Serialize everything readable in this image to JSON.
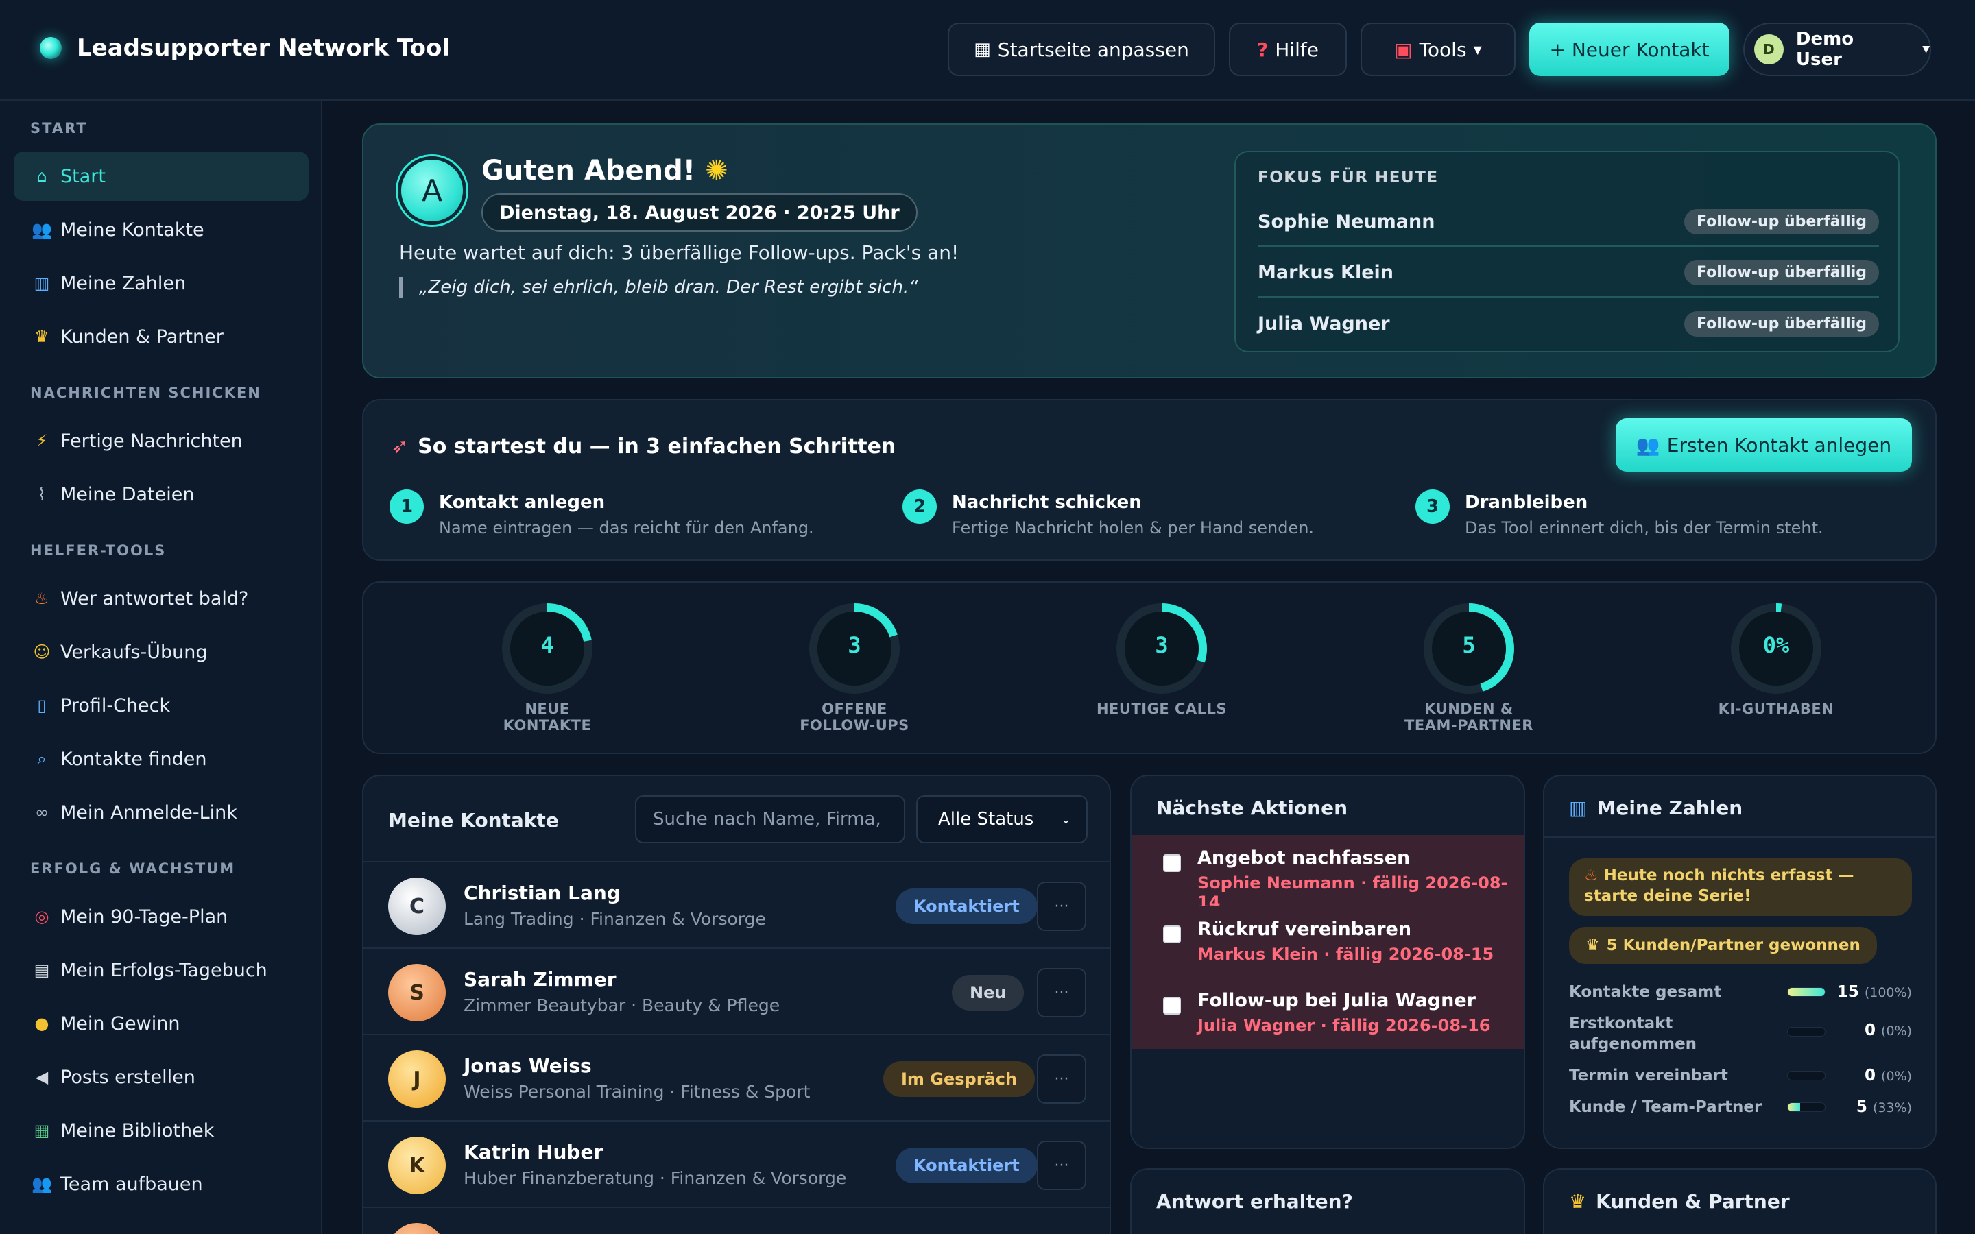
{
  "app": {
    "title": "Leadsupporter Network Tool"
  },
  "topbar": {
    "customize": "Startseite anpassen",
    "help": "Hilfe",
    "tools": "Tools",
    "new_contact": "+ Neuer Kontakt",
    "user_initial": "D",
    "user_name": "Demo User"
  },
  "sidebar": {
    "sections": [
      "START",
      "NACHRICHTEN SCHICKEN",
      "HELFER-TOOLS",
      "ERFOLG & WACHSTUM"
    ],
    "items": [
      {
        "label": "Start",
        "icon": "house-icon"
      },
      {
        "label": "Meine Kontakte",
        "icon": "people-icon"
      },
      {
        "label": "Meine Zahlen",
        "icon": "bar-chart-icon"
      },
      {
        "label": "Kunden & Partner",
        "icon": "trophy-icon"
      },
      {
        "label": "Fertige Nachrichten",
        "icon": "lightning-icon"
      },
      {
        "label": "Meine Dateien",
        "icon": "paperclip-icon"
      },
      {
        "label": "Wer antwortet bald?",
        "icon": "fire-icon"
      },
      {
        "label": "Verkaufs-Übung",
        "icon": "masks-icon"
      },
      {
        "label": "Profil-Check",
        "icon": "phone-icon"
      },
      {
        "label": "Kontakte finden",
        "icon": "magnifier-icon"
      },
      {
        "label": "Mein Anmelde-Link",
        "icon": "link-icon"
      },
      {
        "label": "Mein 90-Tage-Plan",
        "icon": "target-icon"
      },
      {
        "label": "Mein Erfolgs-Tagebuch",
        "icon": "notebook-icon"
      },
      {
        "label": "Mein Gewinn",
        "icon": "money-bag-icon"
      },
      {
        "label": "Posts erstellen",
        "icon": "megaphone-icon"
      },
      {
        "label": "Meine Bibliothek",
        "icon": "books-icon"
      },
      {
        "label": "Team aufbauen",
        "icon": "people-icon"
      }
    ]
  },
  "hero": {
    "initial": "A",
    "greeting": "Guten Abend!",
    "date": "Dienstag, 18. August 2026 · 20:25 Uhr",
    "message": "Heute wartet auf dich: 3 überfällige Follow-ups. Pack's an!",
    "quote": "„Zeig dich, sei ehrlich, bleib dran. Der Rest ergibt sich.“",
    "focus_title": "FOKUS FÜR HEUTE",
    "focus": [
      {
        "name": "Sophie Neumann",
        "badge": "Follow-up überfällig"
      },
      {
        "name": "Markus Klein",
        "badge": "Follow-up überfällig"
      },
      {
        "name": "Julia Wagner",
        "badge": "Follow-up überfällig"
      }
    ]
  },
  "onboarding": {
    "title": "So startest du — in 3 einfachen Schritten",
    "cta": "Ersten Kontakt anlegen",
    "steps": [
      {
        "num": "1",
        "title": "Kontakt anlegen",
        "sub": "Name eintragen — das reicht für den Anfang."
      },
      {
        "num": "2",
        "title": "Nachricht schicken",
        "sub": "Fertige Nachricht holen & per Hand senden."
      },
      {
        "num": "3",
        "title": "Dranbleiben",
        "sub": "Das Tool erinnert dich, bis der Termin steht."
      }
    ]
  },
  "kpis": [
    {
      "value": "4",
      "label1": "NEUE",
      "label2": "KONTAKTE",
      "fraction": 0.22
    },
    {
      "value": "3",
      "label1": "OFFENE",
      "label2": "FOLLOW-UPS",
      "fraction": 0.2
    },
    {
      "value": "3",
      "label1": "HEUTIGE CALLS",
      "label2": "",
      "fraction": 0.3
    },
    {
      "value": "5",
      "label1": "KUNDEN &",
      "label2": "TEAM-PARTNER",
      "fraction": 0.45
    },
    {
      "value": "0%",
      "label1": "KI-GUTHABEN",
      "label2": "",
      "fraction": 0.02
    }
  ],
  "contacts": {
    "title": "Meine Kontakte",
    "search_placeholder": "Suche nach Name, Firma,",
    "filter": "Alle Status",
    "rows": [
      {
        "initial": "C",
        "name": "Christian Lang",
        "sub": "Lang Trading · Finanzen & Vorsorge",
        "status": "Kontaktiert"
      },
      {
        "initial": "S",
        "name": "Sarah Zimmer",
        "sub": "Zimmer Beautybar · Beauty & Pflege",
        "status": "Neu"
      },
      {
        "initial": "J",
        "name": "Jonas Weiss",
        "sub": "Weiss Personal Training · Fitness & Sport",
        "status": "Im Gespräch"
      },
      {
        "initial": "K",
        "name": "Katrin Huber",
        "sub": "Huber Finanzberatung · Finanzen & Vorsorge",
        "status": "Kontaktiert"
      }
    ]
  },
  "actions": {
    "title": "Nächste Aktionen",
    "items": [
      {
        "title": "Angebot nachfassen",
        "sub": "Sophie Neumann · fällig 2026-08-14"
      },
      {
        "title": "Rückruf vereinbaren",
        "sub": "Markus Klein · fällig 2026-08-15"
      },
      {
        "title": "Follow-up bei Julia Wagner",
        "sub": "Julia Wagner · fällig 2026-08-16"
      }
    ]
  },
  "answer": {
    "title": "Antwort erhalten?"
  },
  "zahlen": {
    "title": "Meine Zahlen",
    "streak": "Heute noch nichts erfasst — starte deine Serie!",
    "won": "5 Kunden/Partner gewonnen",
    "rows": [
      {
        "label": "Kontakte gesamt",
        "value": "15",
        "pct": "(100%)",
        "fraction": 1.0
      },
      {
        "label": "Erstkontakt aufgenommen",
        "value": "0",
        "pct": "(0%)",
        "fraction": 0
      },
      {
        "label": "Termin vereinbart",
        "value": "0",
        "pct": "(0%)",
        "fraction": 0
      },
      {
        "label": "Kunde / Team-Partner",
        "value": "5",
        "pct": "(33%)",
        "fraction": 0.33
      }
    ]
  },
  "partners": {
    "title": "Kunden & Partner"
  }
}
